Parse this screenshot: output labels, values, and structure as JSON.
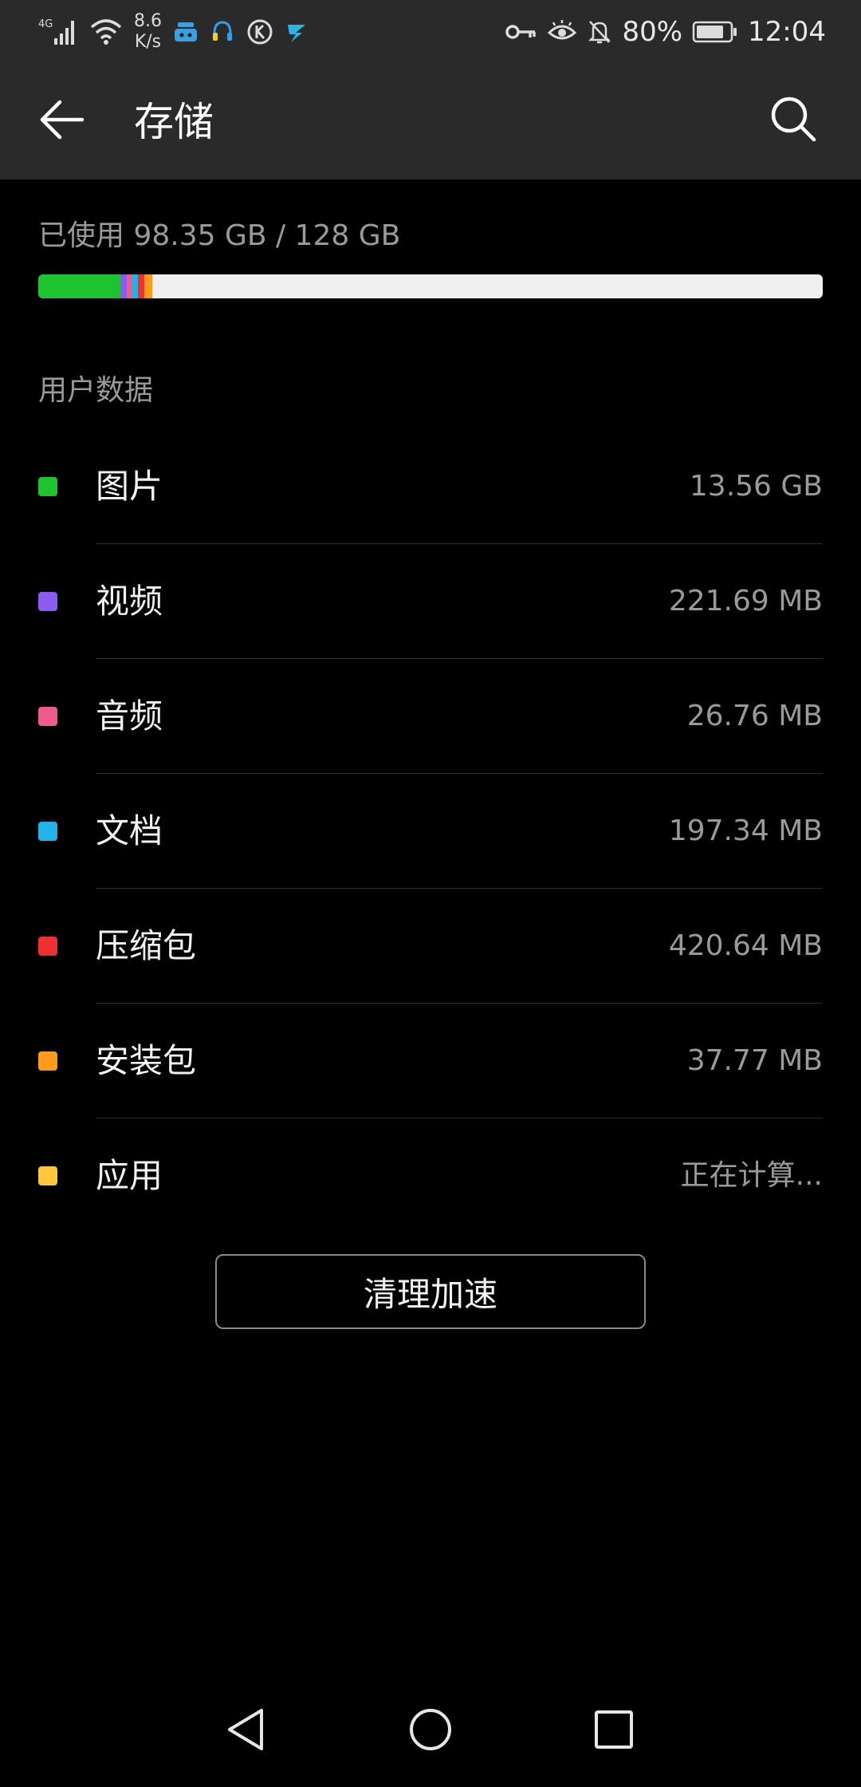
{
  "status_bar": {
    "network_type": "4G",
    "net_speed_value": "8.6",
    "net_speed_unit": "K/s",
    "battery_percent": "80%",
    "time": "12:04",
    "icons": [
      "signal-icon",
      "wifi-icon",
      "app-notification-icon",
      "headset-icon",
      "k-app-icon",
      "bolt-app-icon",
      "key-icon",
      "eye-icon",
      "mute-bell-icon",
      "battery-icon"
    ]
  },
  "header": {
    "title": "存储",
    "back_icon": "arrow-left-icon",
    "search_icon": "search-icon"
  },
  "usage": {
    "text": "已使用 98.35 GB / 128 GB",
    "used_fraction": 0.768,
    "track_color": "#f0f0f0"
  },
  "section": {
    "title": "用户数据"
  },
  "categories": [
    {
      "label": "图片",
      "size": "13.56 GB",
      "color": "#1ec42e"
    },
    {
      "label": "视频",
      "size": "221.69 MB",
      "color": "#8a5cf0"
    },
    {
      "label": "音频",
      "size": "26.76 MB",
      "color": "#f05a8c"
    },
    {
      "label": "文档",
      "size": "197.34 MB",
      "color": "#22b4e6"
    },
    {
      "label": "压缩包",
      "size": "420.64 MB",
      "color": "#f03030"
    },
    {
      "label": "安装包",
      "size": "37.77 MB",
      "color": "#ff9a1a"
    },
    {
      "label": "应用",
      "size": "正在计算...",
      "color": "#ffc83a"
    }
  ],
  "clean_button": {
    "label": "清理加速"
  },
  "nav_bar": {
    "icons": [
      "nav-back-icon",
      "nav-home-icon",
      "nav-recents-icon"
    ]
  }
}
